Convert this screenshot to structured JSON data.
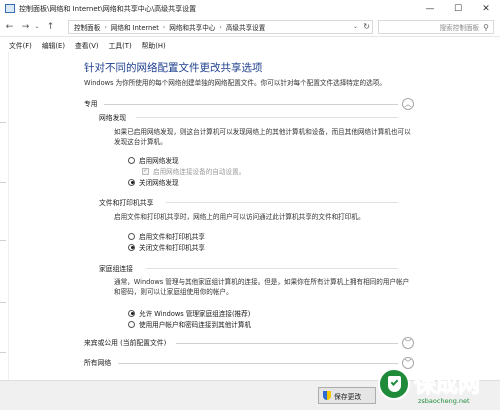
{
  "window": {
    "title": "控制面板\\网络和 Internet\\网络和共享中心\\高级共享设置",
    "controls": [
      "—",
      "☐",
      "✕"
    ]
  },
  "navigation": {
    "back": "←",
    "forward": "→",
    "recent": "⌄",
    "up": "↑",
    "breadcrumb": [
      "控制面板",
      "网络和 Internet",
      "网络和共享中心",
      "高级共享设置"
    ],
    "search_placeholder": "搜索控制面板"
  },
  "menu": [
    "文件(F)",
    "编辑(E)",
    "查看(V)",
    "工具(T)",
    "帮助(H)"
  ],
  "page": {
    "title": "针对不同的网络配置文件更改共享选项",
    "intro": "Windows 为你所使用的每个网络创建单独的网络配置文件。你可以针对每个配置文件选择特定的选项。"
  },
  "profiles": {
    "private": {
      "label": "专用",
      "network_discovery": {
        "title": "网络发现",
        "desc": "如果已启用网络发现，则这台计算机可以发现网络上的其他计算机和设备，而且其他网络计算机也可以发现这台计算机。",
        "options": [
          "启用网络发现",
          "关闭网络发现"
        ],
        "auto_setup": "启用网络连接设备的自动设置。",
        "selected": 1
      },
      "file_printer": {
        "title": "文件和打印机共享",
        "desc": "启用文件和打印机共享时，网络上的用户可以访问通过此计算机共享的文件和打印机。",
        "options": [
          "启用文件和打印机共享",
          "关闭文件和打印机共享"
        ],
        "selected": 1
      },
      "homegroup": {
        "title": "家庭组连接",
        "desc": "通常，Windows 管理与其他家庭组计算机的连接。但是，如果你在所有计算机上拥有相同的用户帐户和密码，则可以让家庭组使用你的帐户。",
        "options": [
          "允许 Windows 管理家庭组连接(推荐)",
          "使用用户帐户和密码连接到其他计算机"
        ],
        "selected": 0
      }
    },
    "guest": {
      "label": "来宾或公用 (当前配置文件)"
    },
    "all": {
      "label": "所有网络"
    }
  },
  "footer": {
    "save_label": "保存更改"
  },
  "icons": {
    "expand_up": "︿",
    "expand_down": "﹀",
    "search": "⚲",
    "refresh": "↻"
  },
  "watermark": {
    "text": "保成网",
    "sub": "zsbaocheng.net"
  },
  "colors": {
    "title_blue": "#1e3f8e",
    "watermark_green": "#1f8b3a"
  }
}
